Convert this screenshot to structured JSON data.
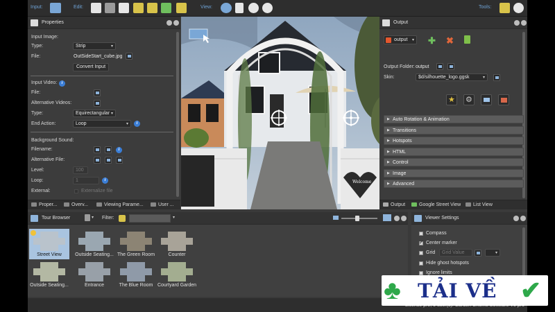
{
  "toolbar": {
    "input_label": "Input:",
    "edit_label": "Edit:",
    "view_label": "View:",
    "tools_label": "Tools:"
  },
  "properties": {
    "title": "Properties",
    "input_image_heading": "Input Image:",
    "type_label": "Type:",
    "type_value": "Strip",
    "file_label": "File:",
    "file_value": "OutSideStart_cube.jpg",
    "convert_button": "Convert Input",
    "input_video_heading": "Input Video:",
    "video_file_label": "File:",
    "alt_videos_label": "Alternative Videos:",
    "video_type_label": "Type:",
    "video_type_value": "Equirectangular",
    "end_action_label": "End Action:",
    "end_action_value": "Loop",
    "bg_sound_heading": "Background Sound:",
    "filename_label": "Filename:",
    "alt_file_label": "Alternative File:",
    "level_label": "Level:",
    "level_value": "100",
    "loop_label": "Loop:",
    "loop_value": "1",
    "external_label": "External:",
    "external_value": "Externalize file",
    "tabs": [
      "Proper...",
      "Overv...",
      "Viewing Parame...",
      "User ..."
    ]
  },
  "output": {
    "title": "Output",
    "format_value": "output",
    "folder_label": "Output Folder:",
    "folder_value": "output",
    "skin_label": "Skin:",
    "skin_value": "$d/silhouette_logo.ggsk",
    "sections": [
      "Auto Rotation & Animation",
      "Transitions",
      "Hotspots",
      "HTML",
      "Control",
      "Image",
      "Advanced"
    ],
    "tabs": [
      "Output",
      "Google Street View",
      "List View"
    ]
  },
  "tour_browser": {
    "title": "Tour Browser",
    "filter_label": "Filter:",
    "filter_value": "",
    "nodes": [
      {
        "caption": "Street View",
        "selected": true
      },
      {
        "caption": "Outside Seating...",
        "selected": false
      },
      {
        "caption": "The Green Room",
        "selected": false
      },
      {
        "caption": "Counter",
        "selected": false
      },
      {
        "caption": "Outside Seating...",
        "selected": false
      },
      {
        "caption": "Entrance",
        "selected": false
      },
      {
        "caption": "The Blue Room",
        "selected": false
      },
      {
        "caption": "Courtyard Garden",
        "selected": false
      }
    ]
  },
  "viewer_settings": {
    "title": "Viewer Settings",
    "compass_label": "Compass",
    "compass_checked": false,
    "center_marker_label": "Center marker",
    "center_marker_checked": true,
    "grid_label": "Grid",
    "grid_checked": false,
    "grid_value": "Grid Value",
    "hide_ghost_label": "Hide ghost hotspots",
    "hide_ghost_checked": false,
    "ignore_limits_label": "Ignore limits",
    "ignore_limits_checked": false
  },
  "statusbar": {
    "license_text": "License pro, 5 user(s): Garden Gnome Software V5 pro"
  },
  "viewer": {
    "sign_text": "Welcome"
  },
  "watermark": {
    "text": "TẢI VỀ"
  },
  "colors": {
    "accent_blue": "#3b7ed6",
    "selection": "#a9c4e0",
    "html5_orange": "#e4572e",
    "watermark_blue": "#1c2f8a"
  }
}
